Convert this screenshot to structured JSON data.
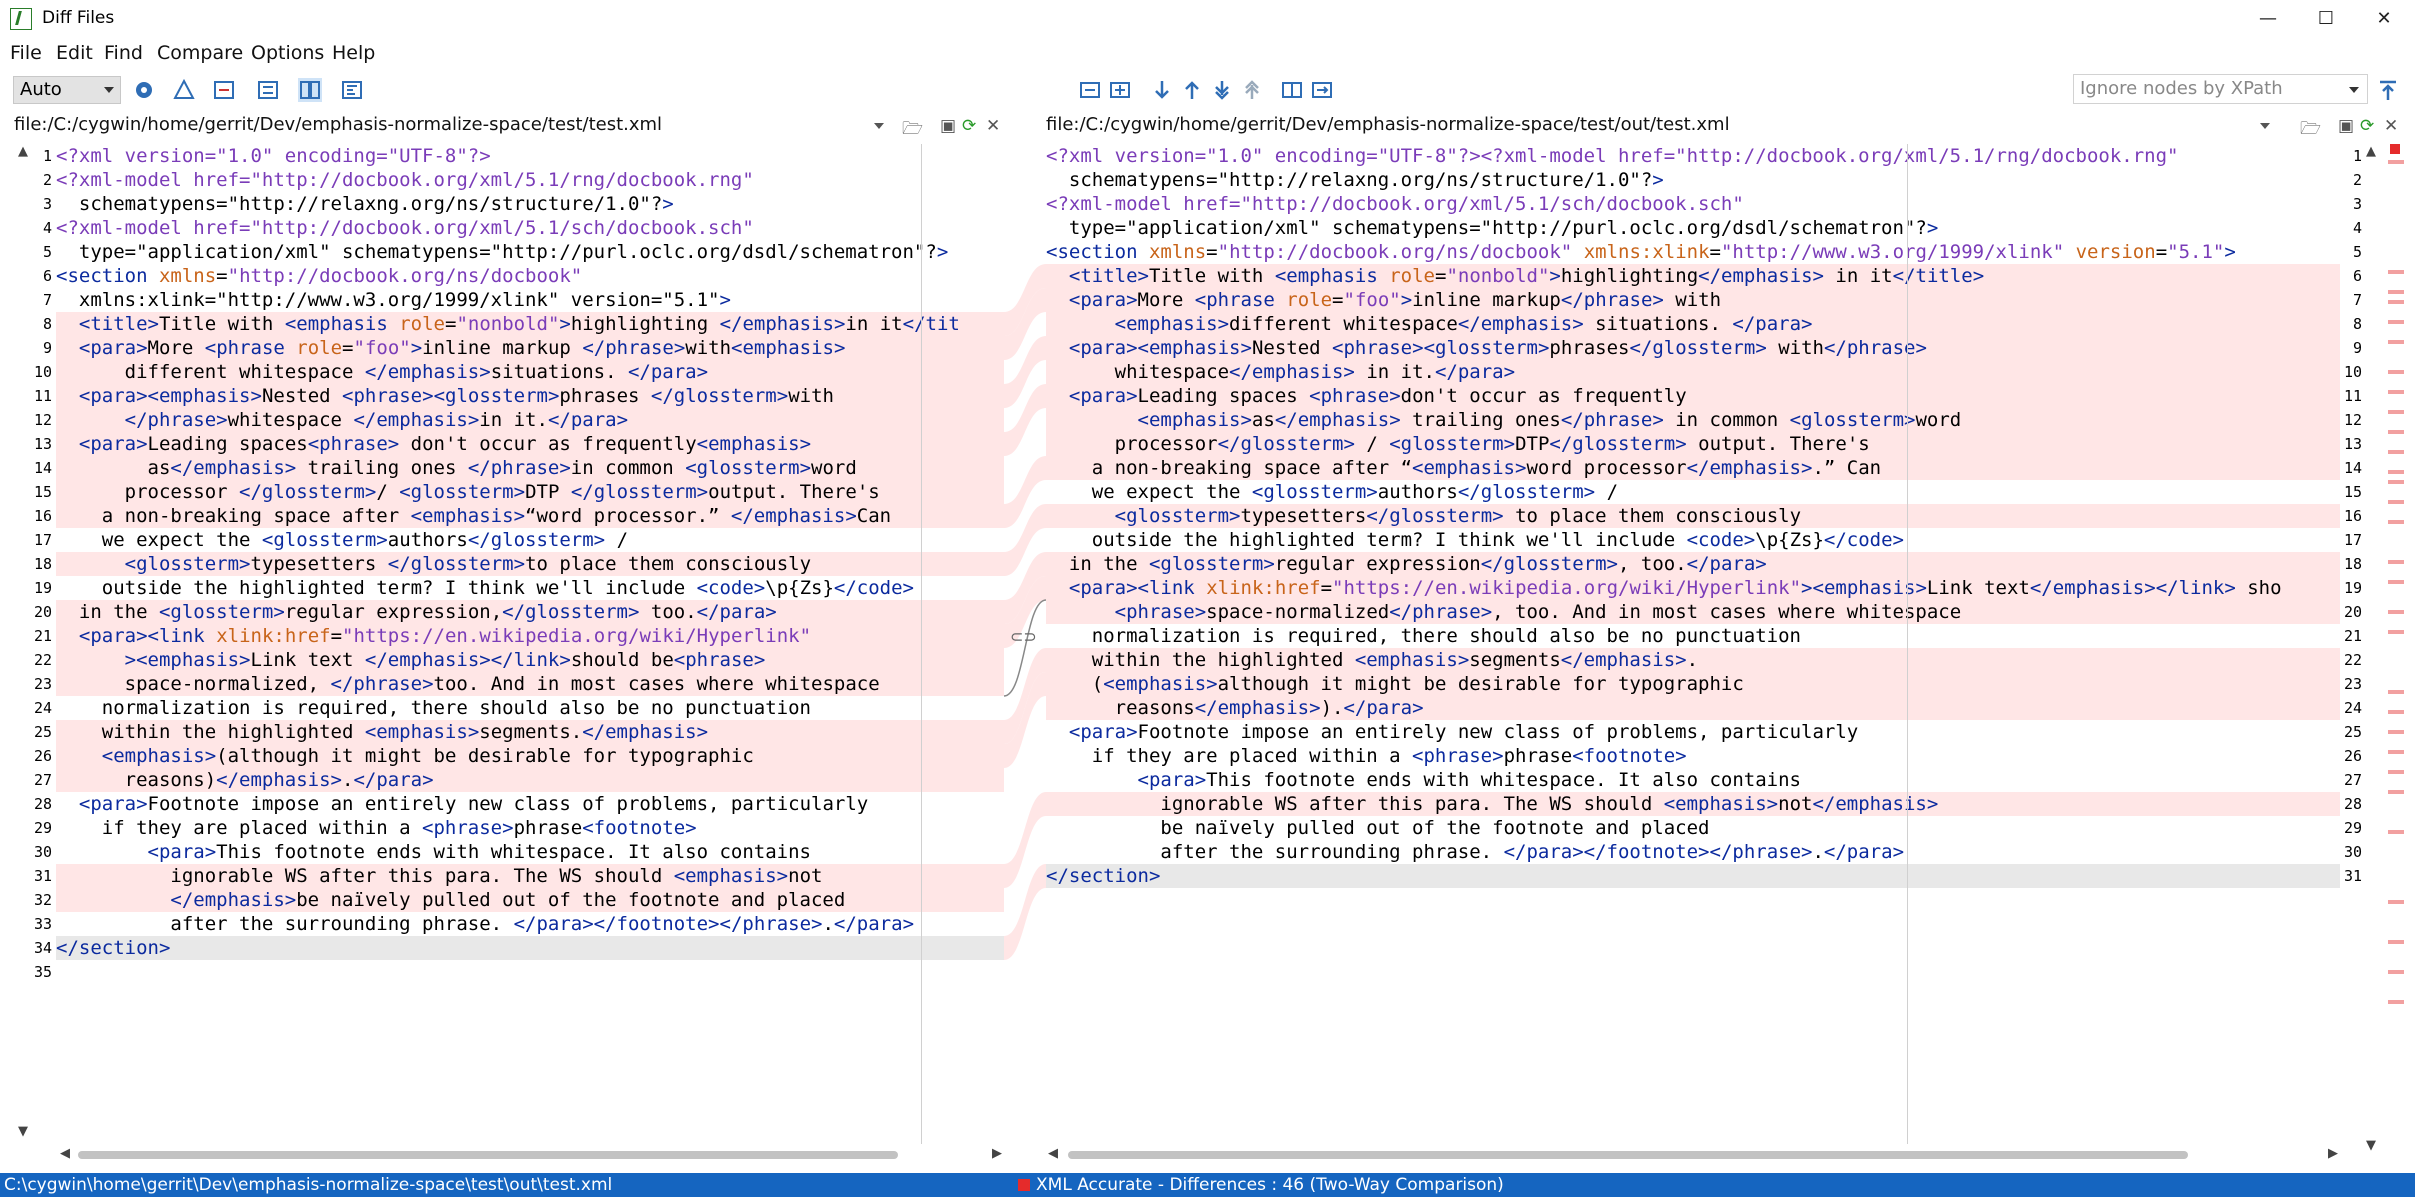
{
  "window": {
    "title": "Diff Files",
    "minimize": "—",
    "maximize": "☐",
    "close": "✕"
  },
  "menu": [
    "File",
    "Edit",
    "Find",
    "Compare",
    "Options",
    "Help"
  ],
  "toolbar": {
    "mode": "Auto",
    "xpath_placeholder": "Ignore nodes by XPath"
  },
  "left": {
    "path": "file:/C:/cygwin/home/gerrit/Dev/emphasis-normalize-space/test/test.xml",
    "lines": [
      "<?xml version=\"1.0\" encoding=\"UTF-8\"?>",
      "<?xml-model href=\"http://docbook.org/xml/5.1/rng/docbook.rng\"",
      "  schematypens=\"http://relaxng.org/ns/structure/1.0\"?>",
      "<?xml-model href=\"http://docbook.org/xml/5.1/sch/docbook.sch\"",
      "  type=\"application/xml\" schematypens=\"http://purl.oclc.org/dsdl/schematron\"?>",
      "<section xmlns=\"http://docbook.org/ns/docbook\"",
      "  xmlns:xlink=\"http://www.w3.org/1999/xlink\" version=\"5.1\">",
      "  <title>Title with <emphasis role=\"nonbold\">highlighting </emphasis>in it</tit",
      "  <para>More <phrase role=\"foo\">inline markup </phrase>with<emphasis>",
      "      different whitespace </emphasis>situations. </para>",
      "  <para><emphasis>Nested <phrase><glossterm>phrases </glossterm>with",
      "      </phrase>whitespace </emphasis>in it.</para>",
      "  <para>Leading spaces<phrase> don't occur as frequently<emphasis>",
      "        as</emphasis> trailing ones </phrase>in common <glossterm>word",
      "      processor </glossterm>/ <glossterm>DTP </glossterm>output. There's",
      "    a non-breaking space after <emphasis>“word processor.” </emphasis>Can",
      "    we expect the <glossterm>authors</glossterm> /",
      "      <glossterm>typesetters </glossterm>to place them consciously",
      "    outside the highlighted term? I think we'll include <code>\\p{Zs}</code>",
      "  in the <glossterm>regular expression,</glossterm> too.</para>",
      "  <para><link xlink:href=\"https://en.wikipedia.org/wiki/Hyperlink\"",
      "      ><emphasis>Link text </emphasis></link>should be<phrase>",
      "      space-normalized, </phrase>too. And in most cases where whitespace",
      "    normalization is required, there should also be no punctuation",
      "    within the highlighted <emphasis>segments.</emphasis>",
      "    <emphasis>(although it might be desirable for typographic",
      "      reasons)</emphasis>.</para>",
      "  <para>Footnote impose an entirely new class of problems, particularly",
      "    if they are placed within a <phrase>phrase<footnote>",
      "        <para>This footnote ends with whitespace. It also contains",
      "          ignorable WS after this para. The WS should <emphasis>not",
      "          </emphasis>be naïvely pulled out of the footnote and placed",
      "          after the surrounding phrase. </para></footnote></phrase>.</para>",
      "</section>",
      ""
    ]
  },
  "right": {
    "path": "file:/C:/cygwin/home/gerrit/Dev/emphasis-normalize-space/test/out/test.xml",
    "lines": [
      "<?xml version=\"1.0\" encoding=\"UTF-8\"?><?xml-model href=\"http://docbook.org/xml/5.1/rng/docbook.rng\"",
      "  schematypens=\"http://relaxng.org/ns/structure/1.0\"?>",
      "<?xml-model href=\"http://docbook.org/xml/5.1/sch/docbook.sch\"",
      "  type=\"application/xml\" schematypens=\"http://purl.oclc.org/dsdl/schematron\"?>",
      "<section xmlns=\"http://docbook.org/ns/docbook\" xmlns:xlink=\"http://www.w3.org/1999/xlink\" version=\"5.1\">",
      "  <title>Title with <emphasis role=\"nonbold\">highlighting</emphasis> in it</title>",
      "  <para>More <phrase role=\"foo\">inline markup</phrase> with",
      "      <emphasis>different whitespace</emphasis> situations. </para>",
      "  <para><emphasis>Nested <phrase><glossterm>phrases</glossterm> with</phrase>",
      "      whitespace</emphasis> in it.</para>",
      "  <para>Leading spaces <phrase>don't occur as frequently",
      "        <emphasis>as</emphasis> trailing ones</phrase> in common <glossterm>word",
      "      processor</glossterm> / <glossterm>DTP</glossterm> output. There's",
      "    a non-breaking space after “<emphasis>word processor</emphasis>.” Can",
      "    we expect the <glossterm>authors</glossterm> /",
      "      <glossterm>typesetters</glossterm> to place them consciously",
      "    outside the highlighted term? I think we'll include <code>\\p{Zs}</code>",
      "  in the <glossterm>regular expression</glossterm>, too.</para>",
      "  <para><link xlink:href=\"https://en.wikipedia.org/wiki/Hyperlink\"><emphasis>Link text</emphasis></link> sho",
      "      <phrase>space-normalized</phrase>, too. And in most cases where whitespace",
      "    normalization is required, there should also be no punctuation",
      "    within the highlighted <emphasis>segments</emphasis>.",
      "    (<emphasis>although it might be desirable for typographic",
      "      reasons</emphasis>).</para>",
      "  <para>Footnote impose an entirely new class of problems, particularly",
      "    if they are placed within a <phrase>phrase<footnote>",
      "        <para>This footnote ends with whitespace. It also contains",
      "          ignorable WS after this para. The WS should <emphasis>not</emphasis>",
      "          be naïvely pulled out of the footnote and placed",
      "          after the surrounding phrase. </para></footnote></phrase>.</para>",
      "</section>"
    ]
  },
  "status": {
    "left": "C:\\cygwin\\home\\gerrit\\Dev\\emphasis-normalize-space\\test\\out\\test.xml",
    "center": "XML Accurate - Differences : 46 (Two-Way Comparison)"
  },
  "colors": {
    "status_bg": "#1565c0",
    "diff_bg": "#ffe6e6",
    "diff_hl": "#ffd4d4"
  }
}
